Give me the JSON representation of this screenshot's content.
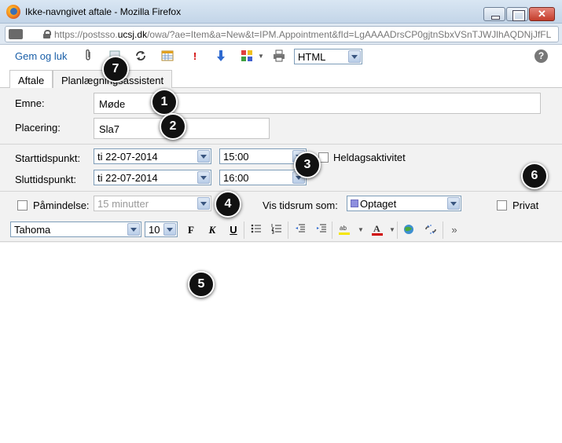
{
  "window": {
    "title": "Ikke-navngivet aftale - Mozilla Firefox",
    "url_prefix": "https://postsso.",
    "url_domain": "ucsj.dk",
    "url_suffix": "/owa/?ae=Item&a=New&t=IPM.Appointment&fId=LgAAAADrsCP0gjtnSbxVSnTJWJlhAQDNjJfFL"
  },
  "toolbar": {
    "save_close_label": "Gem og luk",
    "format_value": "HTML",
    "icons": [
      "paperclip-icon",
      "address-book-icon",
      "recurrence-icon",
      "calendar-grid-icon",
      "importance-high-icon",
      "importance-low-icon",
      "categories-icon",
      "print-icon",
      "help-icon"
    ],
    "help_glyph": "?"
  },
  "tabs": [
    {
      "label": "Aftale",
      "active": true
    },
    {
      "label": "Planlægningsassistent",
      "active": false
    }
  ],
  "form": {
    "subject_label": "Emne:",
    "subject_value": "Møde",
    "location_label": "Placering:",
    "location_value": "Sla7",
    "start_label": "Starttidspunkt:",
    "start_date": "ti 22-07-2014",
    "start_time": "15:00",
    "end_label": "Sluttidspunkt:",
    "end_date": "ti 22-07-2014",
    "end_time": "16:00",
    "allday_label": "Heldagsaktivitet",
    "reminder_label": "Påmindelse:",
    "reminder_value": "15 minutter",
    "show_as_label": "Vis tidsrum som:",
    "show_as_value": "Optaget",
    "show_as_color": "#8e8fde",
    "private_label": "Privat"
  },
  "format_bar": {
    "font": "Tahoma",
    "size": "10",
    "bold": "F",
    "italic": "K",
    "underline": "U"
  },
  "callouts": [
    "1",
    "2",
    "3",
    "4",
    "5",
    "6",
    "7"
  ],
  "colors": {
    "link_blue": "#1a5fa8",
    "form_bg": "#f2f2f2",
    "highlight_yellow": "#f5e600",
    "font_red": "#d00000"
  }
}
